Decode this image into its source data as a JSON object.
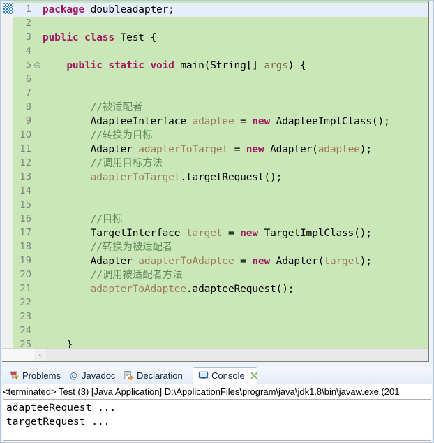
{
  "editor": {
    "current_line": 1,
    "fold_line": 5,
    "annotation_marker": "breakpoint-marker",
    "bg_color": "#c9e7b7",
    "current_line_color": "#e6edfb",
    "keyword_color": "#a01a62",
    "comment_color": "#5f8a5f",
    "localvar_color": "#a07a5a",
    "scroll_left_arrow": "‹",
    "lines": [
      {
        "n": "1",
        "segments": [
          {
            "t": "package ",
            "c": "kw"
          },
          {
            "t": "doubleadapter;",
            "c": "plain"
          }
        ]
      },
      {
        "n": "2",
        "segments": []
      },
      {
        "n": "3",
        "segments": [
          {
            "t": "public class ",
            "c": "kw"
          },
          {
            "t": "Test {",
            "c": "plain"
          }
        ]
      },
      {
        "n": "4",
        "segments": []
      },
      {
        "n": "5",
        "segments": [
          {
            "t": "    ",
            "c": "plain"
          },
          {
            "t": "public static void ",
            "c": "kw"
          },
          {
            "t": "main(String[] ",
            "c": "plain"
          },
          {
            "t": "args",
            "c": "param"
          },
          {
            "t": ") {",
            "c": "plain"
          }
        ]
      },
      {
        "n": "6",
        "segments": []
      },
      {
        "n": "7",
        "segments": []
      },
      {
        "n": "8",
        "segments": [
          {
            "t": "        //被适配者",
            "c": "cmt"
          }
        ]
      },
      {
        "n": "9",
        "segments": [
          {
            "t": "        AdapteeInterface ",
            "c": "plain"
          },
          {
            "t": "adaptee",
            "c": "lvar"
          },
          {
            "t": " = ",
            "c": "plain"
          },
          {
            "t": "new",
            "c": "kw"
          },
          {
            "t": " AdapteeImplClass();",
            "c": "plain"
          }
        ]
      },
      {
        "n": "10",
        "segments": [
          {
            "t": "        //转换为目标",
            "c": "cmt"
          }
        ]
      },
      {
        "n": "11",
        "segments": [
          {
            "t": "        Adapter ",
            "c": "plain"
          },
          {
            "t": "adapterToTarget",
            "c": "lvar"
          },
          {
            "t": " = ",
            "c": "plain"
          },
          {
            "t": "new",
            "c": "kw"
          },
          {
            "t": " Adapter(",
            "c": "plain"
          },
          {
            "t": "adaptee",
            "c": "lvar"
          },
          {
            "t": ");",
            "c": "plain"
          }
        ]
      },
      {
        "n": "12",
        "segments": [
          {
            "t": "        //调用目标方法",
            "c": "cmt"
          }
        ]
      },
      {
        "n": "13",
        "segments": [
          {
            "t": "        ",
            "c": "plain"
          },
          {
            "t": "adapterToTarget",
            "c": "lvar"
          },
          {
            "t": ".targetRequest();",
            "c": "plain"
          }
        ]
      },
      {
        "n": "14",
        "segments": []
      },
      {
        "n": "15",
        "segments": []
      },
      {
        "n": "16",
        "segments": [
          {
            "t": "        //目标",
            "c": "cmt"
          }
        ]
      },
      {
        "n": "17",
        "segments": [
          {
            "t": "        TargetInterface ",
            "c": "plain"
          },
          {
            "t": "target",
            "c": "lvar"
          },
          {
            "t": " = ",
            "c": "plain"
          },
          {
            "t": "new",
            "c": "kw"
          },
          {
            "t": " TargetImplClass();",
            "c": "plain"
          }
        ]
      },
      {
        "n": "18",
        "segments": [
          {
            "t": "        //转换为被适配者",
            "c": "cmt"
          }
        ]
      },
      {
        "n": "19",
        "segments": [
          {
            "t": "        Adapter ",
            "c": "plain"
          },
          {
            "t": "adapterToAdaptee",
            "c": "lvar"
          },
          {
            "t": " = ",
            "c": "plain"
          },
          {
            "t": "new",
            "c": "kw"
          },
          {
            "t": " Adapter(",
            "c": "plain"
          },
          {
            "t": "target",
            "c": "lvar"
          },
          {
            "t": ");",
            "c": "plain"
          }
        ]
      },
      {
        "n": "20",
        "segments": [
          {
            "t": "        //调用被适配者方法",
            "c": "cmt"
          }
        ]
      },
      {
        "n": "21",
        "segments": [
          {
            "t": "        ",
            "c": "plain"
          },
          {
            "t": "adapterToAdaptee",
            "c": "lvar"
          },
          {
            "t": ".adapteeRequest();",
            "c": "plain"
          }
        ]
      },
      {
        "n": "22",
        "segments": []
      },
      {
        "n": "23",
        "segments": []
      },
      {
        "n": "24",
        "segments": []
      },
      {
        "n": "25",
        "segments": [
          {
            "t": "    }",
            "c": "plain"
          }
        ]
      }
    ]
  },
  "bottom_view": {
    "tabs": [
      {
        "label": "Problems",
        "icon": "problems-icon",
        "active": false,
        "closable": false
      },
      {
        "label": "Javadoc",
        "icon": "javadoc-icon",
        "active": false,
        "closable": false
      },
      {
        "label": "Declaration",
        "icon": "declaration-icon",
        "active": false,
        "closable": false
      },
      {
        "label": "Console",
        "icon": "console-icon",
        "active": true,
        "closable": true
      }
    ],
    "console": {
      "launch_line": "<terminated> Test (3) [Java Application] D:\\ApplicationFiles\\program\\java\\jdk1.8\\bin\\javaw.exe (201",
      "output_lines": [
        "adapteeRequest ...",
        "targetRequest ..."
      ]
    }
  }
}
